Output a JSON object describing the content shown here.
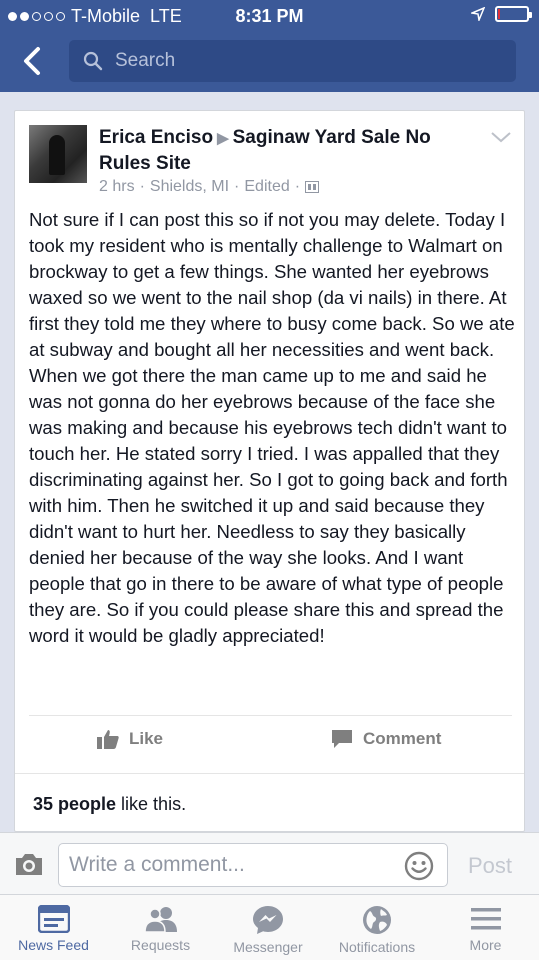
{
  "status_bar": {
    "carrier": "T-Mobile",
    "network": "LTE",
    "time": "8:31 PM",
    "signal_bars": 2,
    "battery_level": 0.05,
    "icons": [
      "signal-dots-icon",
      "location-arrow-icon",
      "battery-icon"
    ]
  },
  "header": {
    "back_icon": "chevron-left-icon",
    "search_placeholder": "Search",
    "search_icon": "search-icon",
    "colors": {
      "header": "#3b5998",
      "search_field": "#2e4a86"
    }
  },
  "post": {
    "author": "Erica Enciso",
    "group": "Saginaw Yard Sale No Rules Site",
    "time": "2 hrs",
    "location": "Shields, MI",
    "edited": "Edited",
    "privacy_icon": "group-icon",
    "menu_icon": "chevron-down-icon",
    "text": "Not sure if I can post this so if not you may delete. Today I took my resident who is mentally challenge to Walmart on brockway to get a few things. She wanted her eyebrows waxed so we went to the nail shop (da vi nails) in there. At first they told me they where to busy come back. So we ate at subway and bought all her necessities and went back. When we got there the man came up to me and said he was not gonna do her eyebrows because of the face she was making and because his eyebrows tech didn't want to touch her. He stated sorry I tried. I was appalled that they discriminating against her. So I got to going back and forth with him. Then he switched it up and said because they didn't want to hurt her. Needless to say they basically denied her because of the way she looks. And I want people that go in there to be aware of what type of people they are. So if you could please share this and spread the word it would be gladly appreciated!",
    "actions": {
      "like": "Like",
      "comment": "Comment"
    },
    "likes_count": "35 people",
    "likes_suffix": "like this."
  },
  "comment_bar": {
    "placeholder": "Write a comment...",
    "post_label": "Post",
    "camera_icon": "camera-icon",
    "emoji_icon": "smiley-icon"
  },
  "tabbar": {
    "tabs": [
      {
        "label": "News Feed",
        "icon": "news-feed-icon",
        "active": true
      },
      {
        "label": "Requests",
        "icon": "friend-requests-icon",
        "active": false
      },
      {
        "label": "Messenger",
        "icon": "messenger-icon",
        "active": false
      },
      {
        "label": "Notifications",
        "icon": "globe-icon",
        "active": false
      },
      {
        "label": "More",
        "icon": "hamburger-menu-icon",
        "active": false
      }
    ],
    "colors": {
      "active": "#4e69a2",
      "inactive": "#9197a3"
    }
  }
}
